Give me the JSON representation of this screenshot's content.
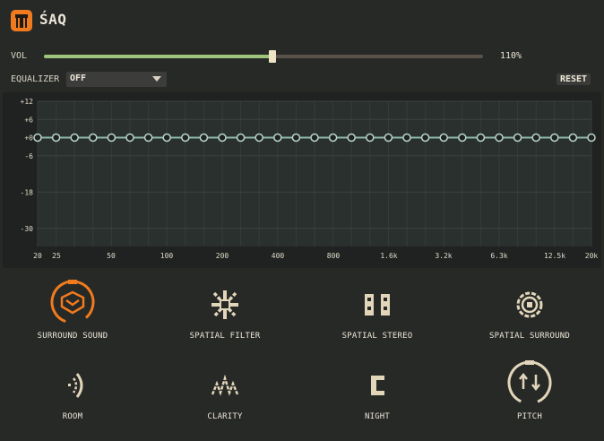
{
  "app": {
    "title": "ŚAQ",
    "logo_icon": "t-logo-icon"
  },
  "volume": {
    "label": "VOL",
    "value_text": "110%",
    "fraction": 0.52
  },
  "equalizer": {
    "label": "EQUALIZER",
    "selected": "OFF",
    "reset_label": "RESET"
  },
  "eq_graph": {
    "y_ticks": [
      "+12",
      "+6",
      "+0",
      "-6",
      "-18",
      "-30"
    ],
    "y_tick_values": [
      12,
      6,
      0,
      -6,
      -18,
      -30
    ],
    "y_range": [
      -36,
      12
    ],
    "x_ticks": [
      "20",
      "25",
      "50",
      "100",
      "200",
      "400",
      "800",
      "1.6k",
      "3.2k",
      "6.3k",
      "12.5k",
      "20k"
    ],
    "band_count": 31,
    "band_gains": [
      0,
      0,
      0,
      0,
      0,
      0,
      0,
      0,
      0,
      0,
      0,
      0,
      0,
      0,
      0,
      0,
      0,
      0,
      0,
      0,
      0,
      0,
      0,
      0,
      0,
      0,
      0,
      0,
      0,
      0,
      0
    ]
  },
  "effects": [
    {
      "label": "SURROUND SOUND",
      "icon": "surround-sound-icon",
      "active": true
    },
    {
      "label": "SPATIAL FILTER",
      "icon": "spatial-filter-icon",
      "active": false
    },
    {
      "label": "SPATIAL STEREO",
      "icon": "spatial-stereo-icon",
      "active": false
    },
    {
      "label": "SPATIAL SURROUND",
      "icon": "spatial-surround-icon",
      "active": false
    },
    {
      "label": "ROOM",
      "icon": "room-icon",
      "active": false
    },
    {
      "label": "CLARITY",
      "icon": "clarity-icon",
      "active": false
    },
    {
      "label": "NIGHT",
      "icon": "night-icon",
      "active": false
    },
    {
      "label": "PITCH",
      "icon": "pitch-icon",
      "active": false
    }
  ],
  "colors": {
    "background": "#272927",
    "accent": "#f07b1e",
    "volume_fill": "#9ec57b",
    "eq_line": "#8fb9a8",
    "icon": "#e2d6ba",
    "label": "#ece6d6"
  }
}
